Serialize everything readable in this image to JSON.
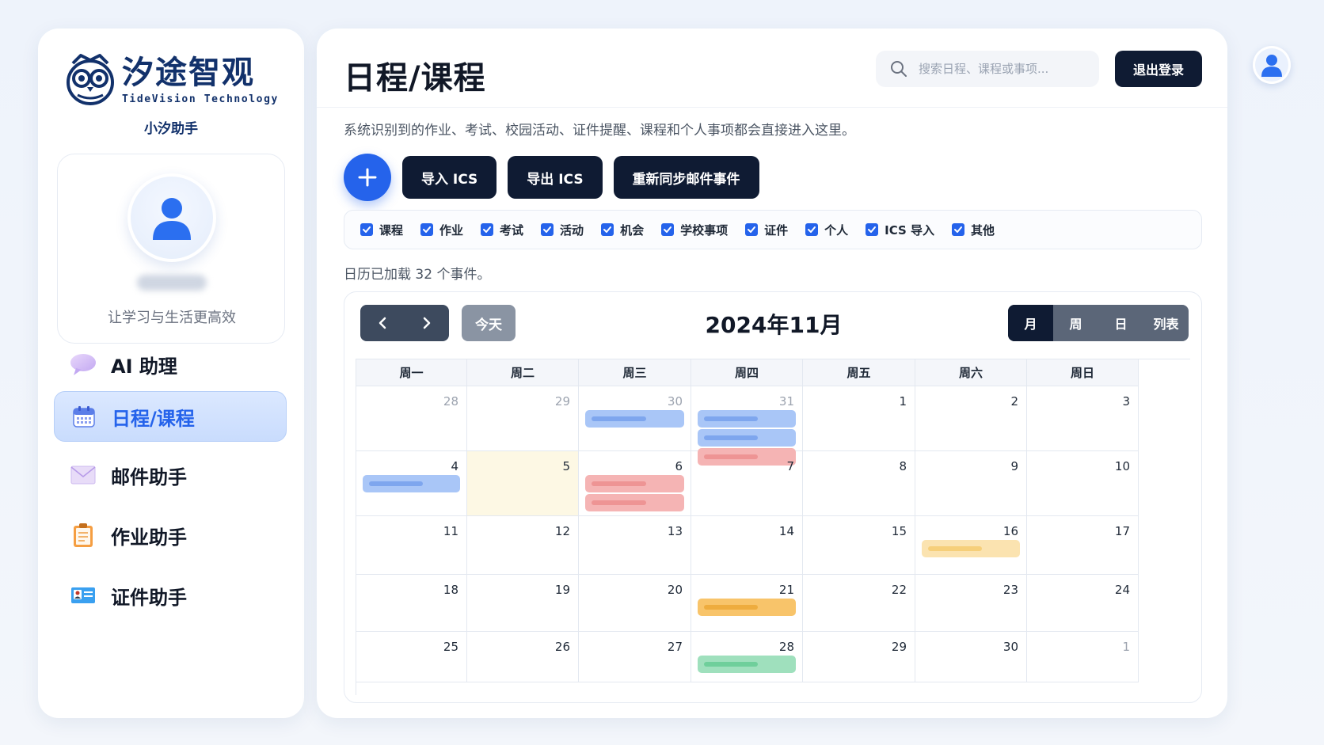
{
  "brand": {
    "name_cn": "汐途智观",
    "name_en": "TideVision Technology",
    "assistant": "小汐助手"
  },
  "profile": {
    "slogan": "让学习与生活更高效"
  },
  "sidebar": {
    "items": [
      {
        "label": "AI 助理",
        "icon": "chat-bubble-icon",
        "active": false
      },
      {
        "label": "日程/课程",
        "icon": "calendar-icon",
        "active": true
      },
      {
        "label": "邮件助手",
        "icon": "envelope-icon",
        "active": false
      },
      {
        "label": "作业助手",
        "icon": "clipboard-icon",
        "active": false
      },
      {
        "label": "证件助手",
        "icon": "id-card-icon",
        "active": false
      }
    ]
  },
  "header": {
    "title": "日程/课程",
    "search_placeholder": "搜索日程、课程或事项...",
    "logout_label": "退出登录"
  },
  "main": {
    "subtitle": "系统识别到的作业、考试、校园活动、证件提醒、课程和个人事项都会直接进入这里。",
    "toolbar": {
      "import_label": "导入 ICS",
      "export_label": "导出 ICS",
      "resync_label": "重新同步邮件事件"
    },
    "filters": [
      "课程",
      "作业",
      "考试",
      "活动",
      "机会",
      "学校事项",
      "证件",
      "个人",
      "ICS 导入",
      "其他"
    ],
    "events_status": "日历已加载 32 个事件。"
  },
  "calendar": {
    "today_label": "今天",
    "month_title": "2024年11月",
    "views": [
      {
        "label": "月",
        "active": true
      },
      {
        "label": "周",
        "active": false
      },
      {
        "label": "日",
        "active": false
      },
      {
        "label": "列表",
        "active": false
      }
    ],
    "weekdays": [
      "周一",
      "周二",
      "周三",
      "周四",
      "周五",
      "周六",
      "周日"
    ],
    "today_date": "5",
    "weeks": [
      [
        "28",
        "29",
        "30",
        "31",
        "1",
        "2",
        "3"
      ],
      [
        "4",
        "5",
        "6",
        "7",
        "8",
        "9",
        "10"
      ],
      [
        "11",
        "12",
        "13",
        "14",
        "15",
        "16",
        "17"
      ],
      [
        "18",
        "19",
        "20",
        "21",
        "22",
        "23",
        "24"
      ],
      [
        "25",
        "26",
        "27",
        "28",
        "29",
        "30",
        "1"
      ]
    ],
    "other_month": [
      [
        true,
        true,
        true,
        true,
        false,
        false,
        false
      ],
      [
        false,
        false,
        false,
        false,
        false,
        false,
        false
      ],
      [
        false,
        false,
        false,
        false,
        false,
        false,
        false
      ],
      [
        false,
        false,
        false,
        false,
        false,
        false,
        false
      ],
      [
        false,
        false,
        false,
        false,
        false,
        false,
        true
      ]
    ],
    "events": [
      {
        "week": 0,
        "day": 2,
        "slot": 0,
        "category": "course"
      },
      {
        "week": 0,
        "day": 3,
        "slot": 0,
        "category": "course"
      },
      {
        "week": 0,
        "day": 3,
        "slot": 1,
        "category": "course"
      },
      {
        "week": 0,
        "day": 3,
        "slot": 2,
        "category": "exam"
      },
      {
        "week": 1,
        "day": 0,
        "slot": 0,
        "category": "course"
      },
      {
        "week": 1,
        "day": 2,
        "slot": 0,
        "category": "exam"
      },
      {
        "week": 1,
        "day": 2,
        "slot": 1,
        "category": "exam"
      },
      {
        "week": 2,
        "day": 5,
        "slot": 0,
        "category": "activity"
      },
      {
        "week": 3,
        "day": 3,
        "slot": 0,
        "category": "homework"
      },
      {
        "week": 4,
        "day": 3,
        "slot": 0,
        "category": "personal"
      }
    ],
    "category_colors": {
      "course": {
        "bg": "#a9c6f7",
        "bar": "#7ea6ee"
      },
      "exam": {
        "bg": "#f5b4b4",
        "bar": "#ee9494"
      },
      "activity": {
        "bg": "#fbe3b0",
        "bar": "#f6cf7a"
      },
      "homework": {
        "bg": "#f8c46a",
        "bar": "#eeac3e"
      },
      "personal": {
        "bg": "#9fe0bd",
        "bar": "#6fcf9b"
      }
    }
  },
  "colors": {
    "accent": "#2563eb",
    "dark": "#0f1b33",
    "today_bg": "#fdf8e4"
  }
}
